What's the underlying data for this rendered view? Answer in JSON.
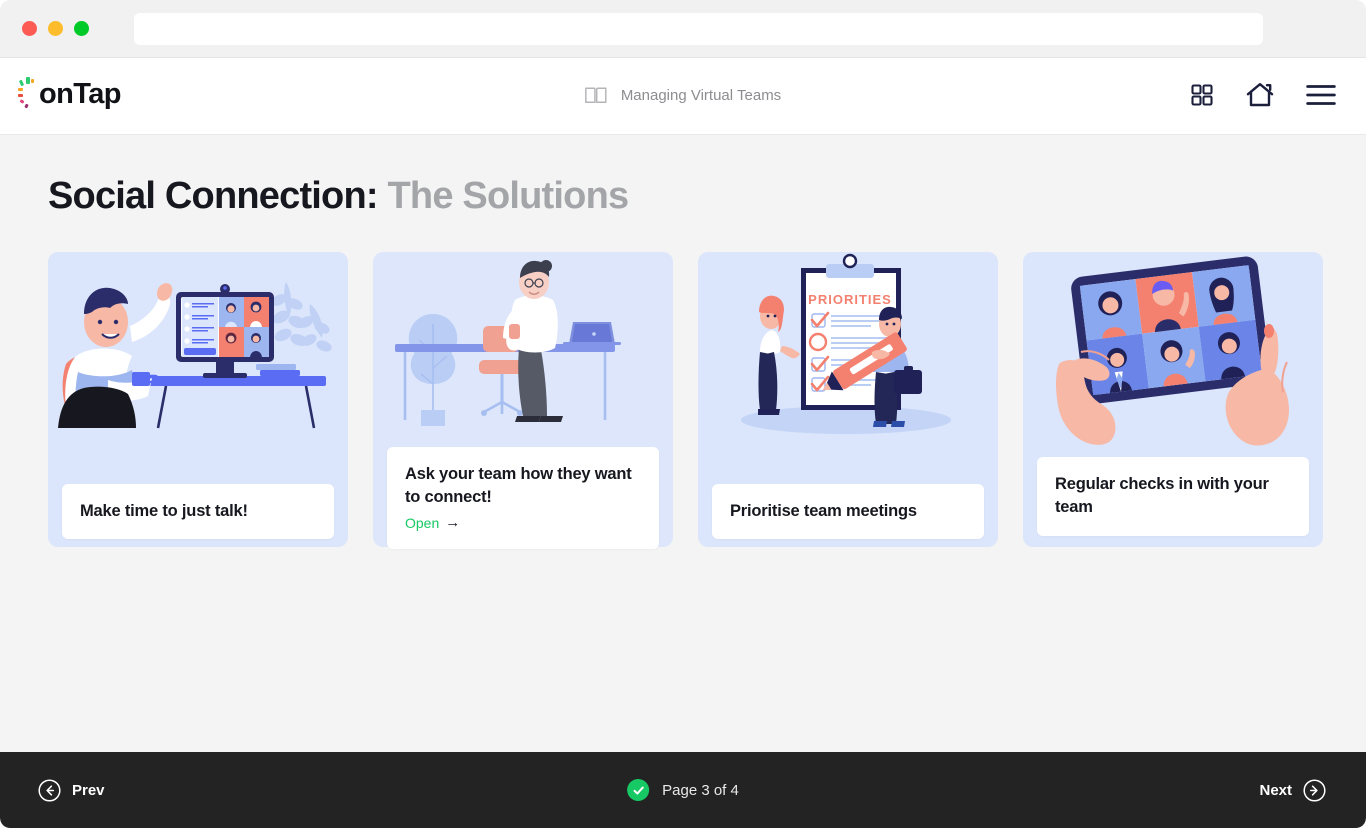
{
  "browser": {
    "url_value": "",
    "url_placeholder": "",
    "controls": [
      "close",
      "minimize",
      "maximize"
    ]
  },
  "header": {
    "logo_text": "onTap",
    "book_icon": "open-book-icon",
    "course_title": "Managing Virtual Teams",
    "actions": [
      {
        "name": "grid-icon",
        "label": "Grid view"
      },
      {
        "name": "home-icon",
        "label": "Home"
      },
      {
        "name": "menu-icon",
        "label": "Menu"
      }
    ]
  },
  "main": {
    "title_primary": "Social Connection:",
    "title_secondary": "The Solutions",
    "cards": [
      {
        "title": "Make time to just talk!",
        "art": "man-waving-video-call",
        "link": null
      },
      {
        "title": "Ask your team how they want to connect!",
        "art": "woman-standing-desk-laptop",
        "link": {
          "label": "Open",
          "arrow": "→"
        }
      },
      {
        "title": "Prioritise team meetings",
        "art": "priorities-clipboard",
        "link": null
      },
      {
        "title": "Regular checks in with your team",
        "art": "tablet-video-grid",
        "link": null
      }
    ]
  },
  "footer": {
    "prev_label": "Prev",
    "next_label": "Next",
    "page_label": "Page 3 of 4",
    "check_glyph": "✓"
  },
  "colors": {
    "accent_green": "#17c964",
    "card_bg": "#dbe5fb",
    "page_bg": "#f4f4f4",
    "footer_bg": "#232323",
    "title_dark": "#17181f",
    "title_muted": "#a4a5a8",
    "illustration_navy": "#2b2d6b",
    "illustration_coral": "#f4806f",
    "illustration_blue": "#5a6cf3"
  }
}
